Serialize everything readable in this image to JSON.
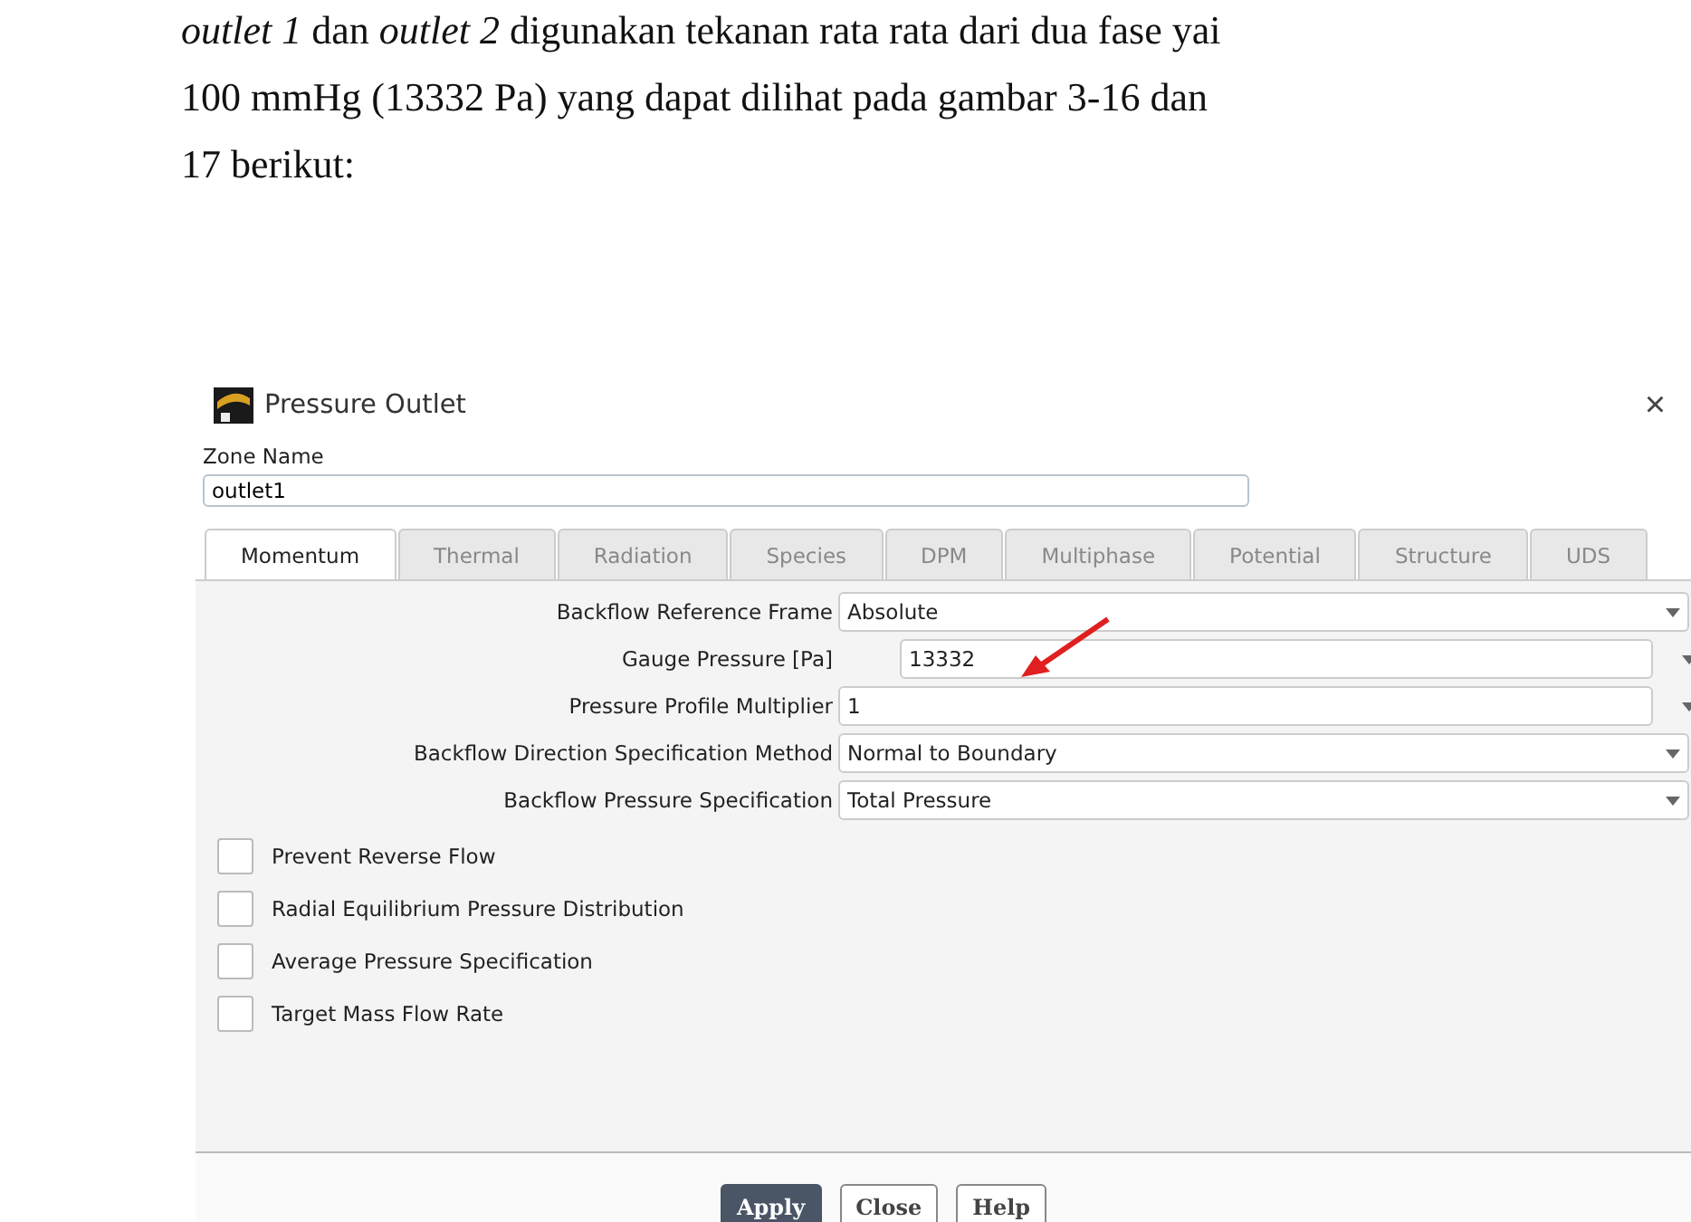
{
  "document": {
    "lines": [
      "*outlet 1* dan *outlet 2* digunakan tekanan rata rata dari dua fase yai",
      "100 mmHg (13332 Pa) yang dapat dilihat pada gambar 3-16 dan",
      "17 berikut:"
    ]
  },
  "dialog": {
    "title": "Pressure Outlet",
    "close": "×",
    "zone": {
      "label": "Zone Name",
      "value": "outlet1"
    },
    "tabs": [
      {
        "label": "Momentum",
        "selected": true
      },
      {
        "label": "Thermal",
        "selected": false
      },
      {
        "label": "Radiation",
        "selected": false
      },
      {
        "label": "Species",
        "selected": false
      },
      {
        "label": "DPM",
        "selected": false
      },
      {
        "label": "Multiphase",
        "selected": false
      },
      {
        "label": "Potential",
        "selected": false
      },
      {
        "label": "Structure",
        "selected": false
      },
      {
        "label": "UDS",
        "selected": false
      }
    ],
    "fields": [
      {
        "kind": "dropdown",
        "label": "Backflow Reference Frame",
        "value": "Absolute"
      },
      {
        "kind": "number",
        "label": "Gauge Pressure [Pa]",
        "value": "13332"
      },
      {
        "kind": "number",
        "label": "Pressure Profile Multiplier",
        "value": "1"
      },
      {
        "kind": "dropdown",
        "label": "Backflow Direction Specification Method",
        "value": "Normal to Boundary"
      },
      {
        "kind": "dropdown",
        "label": "Backflow Pressure Specification",
        "value": "Total Pressure"
      }
    ],
    "options": [
      {
        "label": "Prevent Reverse Flow",
        "checked": false
      },
      {
        "label": "Radial Equilibrium Pressure Distribution",
        "checked": false
      },
      {
        "label": "Average Pressure Specification",
        "checked": false
      },
      {
        "label": "Target Mass Flow Rate",
        "checked": false
      }
    ],
    "buttons": [
      {
        "label": "Apply",
        "primary": true
      },
      {
        "label": "Close",
        "primary": false
      },
      {
        "label": "Help",
        "primary": false
      }
    ]
  }
}
